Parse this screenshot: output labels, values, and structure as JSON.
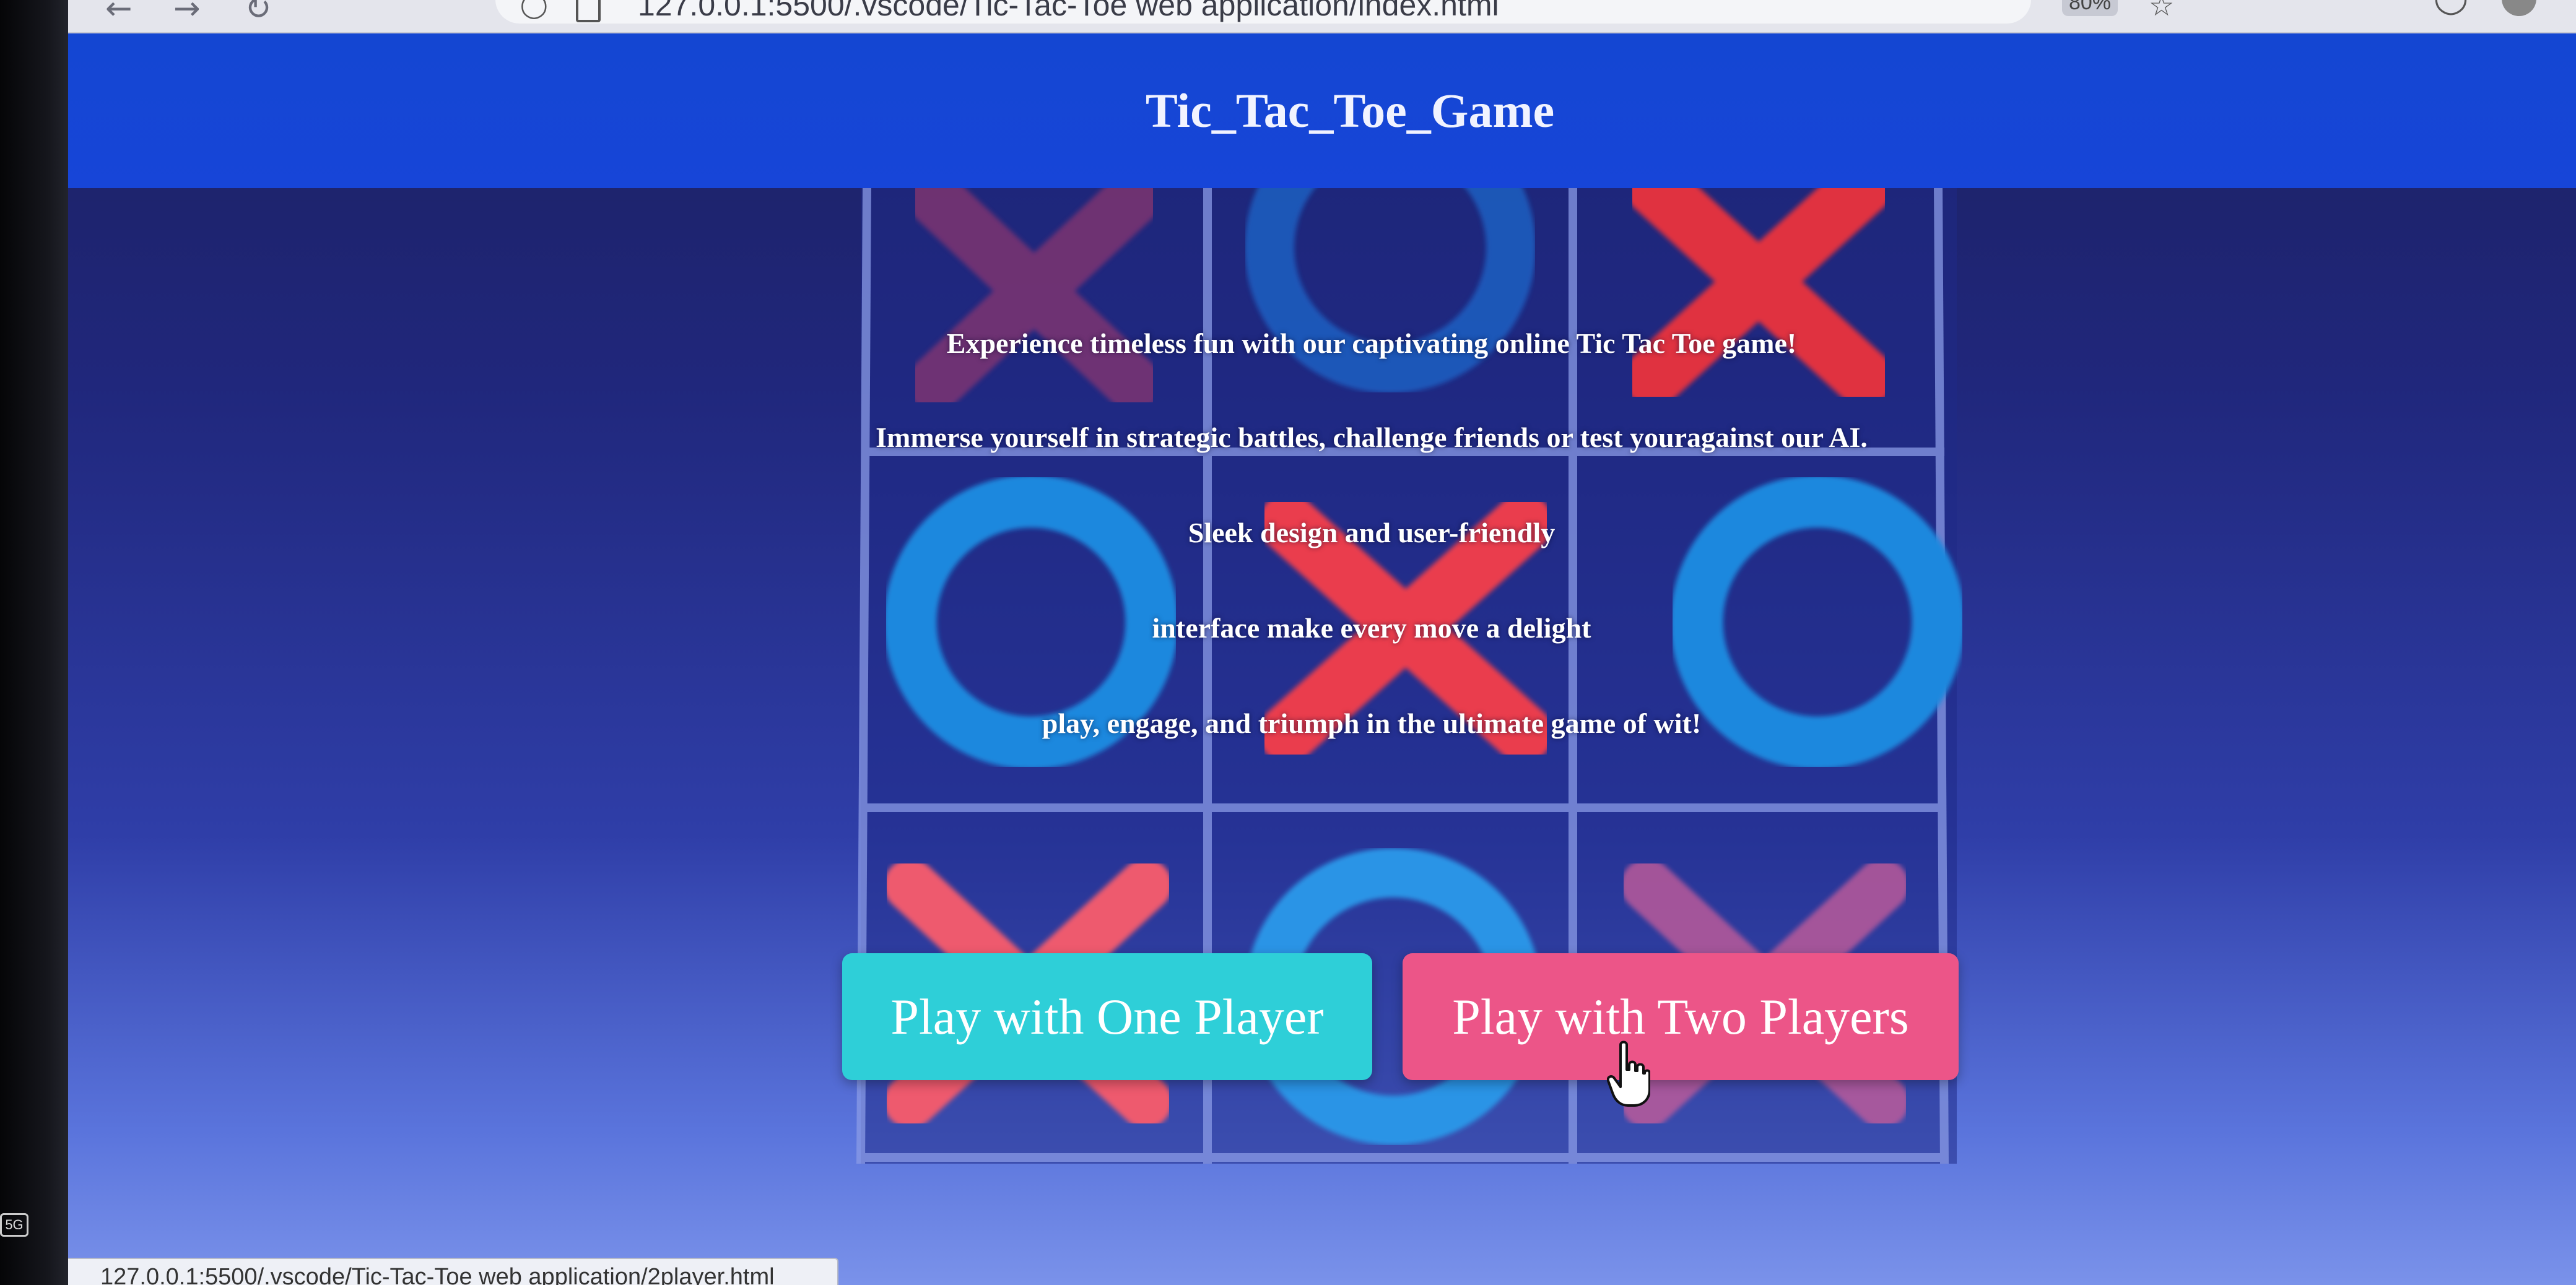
{
  "browser": {
    "url": "127.0.0.1:5500/.vscode/Tic-Tac-Toe web application/index.html",
    "zoom": "80%",
    "status_url": "127.0.0.1:5500/.vscode/Tic-Tac-Toe web application/2player.html"
  },
  "header": {
    "title": "Tic_Tac_Toe_Game"
  },
  "intro": {
    "lines": [
      "Experience timeless fun with our captivating online Tic Tac Toe game!",
      "Immerse yourself in strategic battles, challenge friends or test youragainst our AI.",
      "Sleek design and user-friendly",
      "interface make every move a delight",
      "play, engage, and triumph in the ultimate game of wit!"
    ]
  },
  "buttons": {
    "one_player": "Play with One Player",
    "two_players": "Play with Two Players"
  },
  "icons": {
    "back": "back-arrow-icon",
    "forward": "forward-arrow-icon",
    "reload": "reload-icon",
    "shield": "shield-icon",
    "page": "page-icon",
    "bookmark": "bookmark-star-icon",
    "cursor": "hand-pointer-icon"
  },
  "colors": {
    "header_bg": "#1745d8",
    "one_player_bg": "#2ecfd8",
    "two_players_bg": "#ec5588",
    "x_mark": "#e8364a",
    "o_mark": "#1e8fe0"
  },
  "board": {
    "cells": [
      "X",
      "O",
      "X",
      "O",
      "X",
      "O",
      "X",
      "O",
      "X"
    ]
  }
}
